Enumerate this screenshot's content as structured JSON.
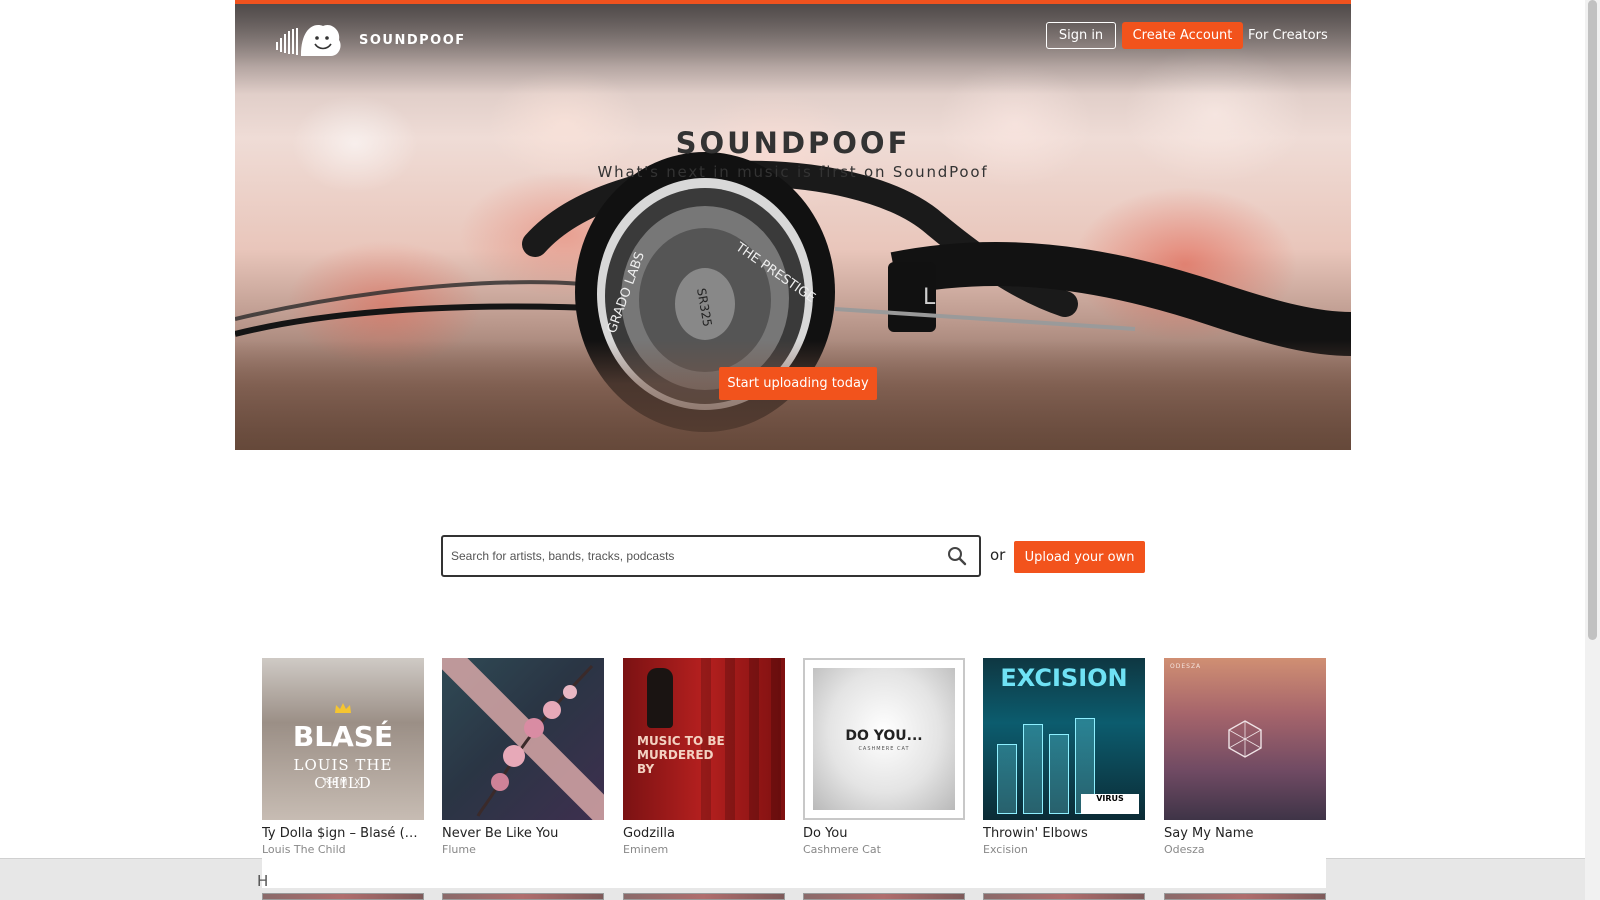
{
  "brand": {
    "name": "SOUNDPOOF",
    "logo_icon": "cloud-smiley-logo"
  },
  "nav": {
    "sign_in": "Sign in",
    "create_account": "Create Account",
    "for_creators": "For Creators"
  },
  "hero": {
    "title": "SOUNDPOOF",
    "subtitle": "What's next in music is first on SoundPoof",
    "cta": "Start uploading today",
    "headphone_text": {
      "brand_top": "THE PRESTIGE",
      "brand_side": "GRADO LABS",
      "model": "SR325",
      "side_mark": "L"
    }
  },
  "search": {
    "placeholder": "Search for artists, bands, tracks, podcasts",
    "value": "",
    "icon": "search-icon",
    "or_label": "or",
    "upload_label": "Upload your own"
  },
  "tracks": [
    {
      "title": "Ty Dolla $ign – Blasé (L...",
      "artist": "Louis The Child",
      "cover_text": [
        "BLASÉ",
        "LOUIS THE CHILD",
        "REMIX"
      ]
    },
    {
      "title": "Never Be Like You",
      "artist": "Flume",
      "cover_text": []
    },
    {
      "title": "Godzilla",
      "artist": "Eminem",
      "cover_text": [
        "MUSIC TO BE",
        "MURDERED",
        "BY"
      ]
    },
    {
      "title": "Do You",
      "artist": "Cashmere Cat",
      "cover_text": [
        "DO YOU...",
        "CASHMERE CAT"
      ]
    },
    {
      "title": "Throwin' Elbows",
      "artist": "Excision",
      "cover_text": [
        "EXCISION",
        "VIRUS"
      ]
    },
    {
      "title": "Say My Name",
      "artist": "Odesza",
      "cover_text": [
        "ODESZA"
      ]
    }
  ],
  "partial_heading": "H",
  "colors": {
    "accent": "#f2531c",
    "text": "#222222",
    "muted": "#888888"
  }
}
